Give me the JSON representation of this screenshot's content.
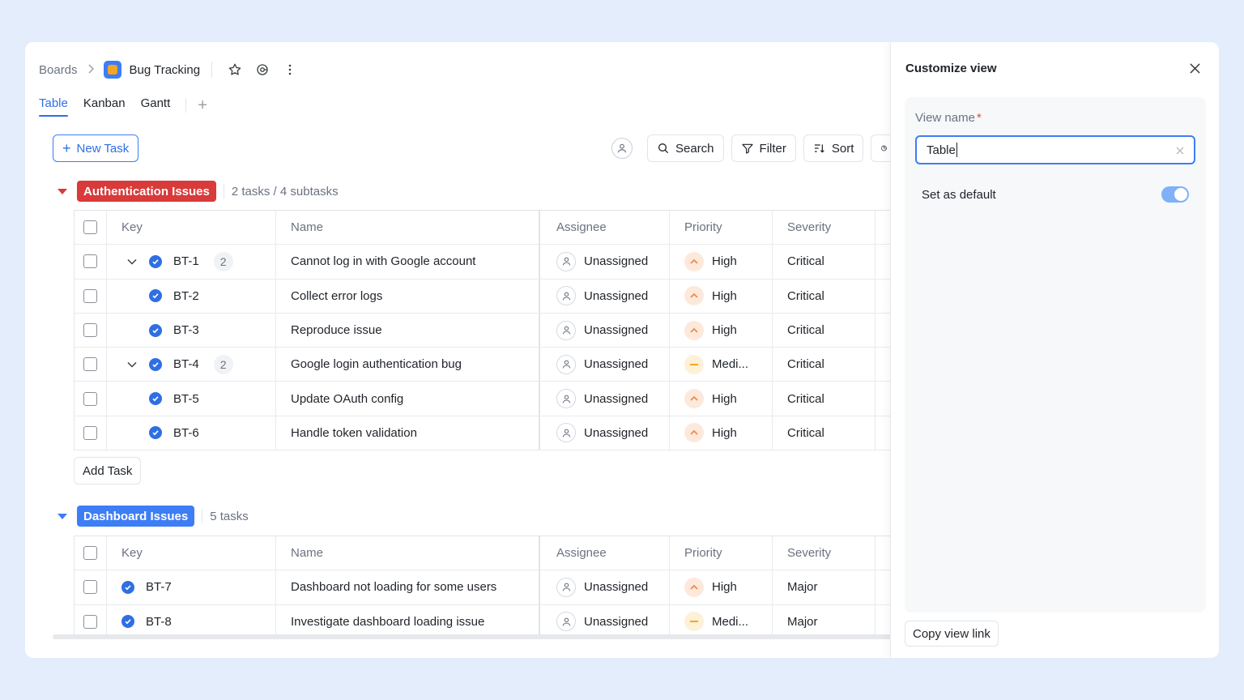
{
  "header": {
    "breadcrumb_root": "Boards",
    "board_title": "Bug Tracking"
  },
  "tabs": [
    {
      "label": "Table",
      "active": true
    },
    {
      "label": "Kanban",
      "active": false
    },
    {
      "label": "Gantt",
      "active": false
    }
  ],
  "toolbar": {
    "new_task": "New Task",
    "search": "Search",
    "filter": "Filter",
    "sort": "Sort"
  },
  "columns": {
    "key": "Key",
    "name": "Name",
    "assignee": "Assignee",
    "priority": "Priority",
    "severity": "Severity"
  },
  "groups": [
    {
      "label": "Authentication Issues",
      "meta": "2 tasks / 4 subtasks",
      "color": "#d93a3a",
      "rows": [
        {
          "key": "BT-1",
          "name": "Cannot log in with Google account",
          "assignee": "Unassigned",
          "priority": "High",
          "severity": "Critical",
          "subtasks": "2",
          "level": 0
        },
        {
          "key": "BT-2",
          "name": "Collect error logs",
          "assignee": "Unassigned",
          "priority": "High",
          "severity": "Critical",
          "level": 1
        },
        {
          "key": "BT-3",
          "name": "Reproduce issue",
          "assignee": "Unassigned",
          "priority": "High",
          "severity": "Critical",
          "level": 1
        },
        {
          "key": "BT-4",
          "name": "Google login authentication bug",
          "assignee": "Unassigned",
          "priority": "Medi...",
          "severity": "Critical",
          "subtasks": "2",
          "level": 0
        },
        {
          "key": "BT-5",
          "name": "Update OAuth config",
          "assignee": "Unassigned",
          "priority": "High",
          "severity": "Critical",
          "level": 1
        },
        {
          "key": "BT-6",
          "name": "Handle token validation",
          "assignee": "Unassigned",
          "priority": "High",
          "severity": "Critical",
          "level": 1
        }
      ],
      "add_task": "Add Task"
    },
    {
      "label": "Dashboard Issues",
      "meta": "5 tasks",
      "color": "#3d7df6",
      "rows": [
        {
          "key": "BT-7",
          "name": "Dashboard not loading for some users",
          "assignee": "Unassigned",
          "priority": "High",
          "severity": "Major"
        },
        {
          "key": "BT-8",
          "name": "Investigate dashboard loading issue",
          "assignee": "Unassigned",
          "priority": "Medi...",
          "severity": "Major"
        }
      ]
    }
  ],
  "panel": {
    "title": "Customize view",
    "view_name_label": "View name",
    "required_mark": "*",
    "view_name_value": "Table",
    "set_default_label": "Set as default",
    "set_default_on": true,
    "copy_link": "Copy view link"
  },
  "colors": {
    "accent": "#2f6fe4",
    "auth_group": "#d93a3a",
    "dashboard_group": "#3d7df6",
    "priority_high": "#f08a4b",
    "priority_medium": "#f5a524"
  }
}
